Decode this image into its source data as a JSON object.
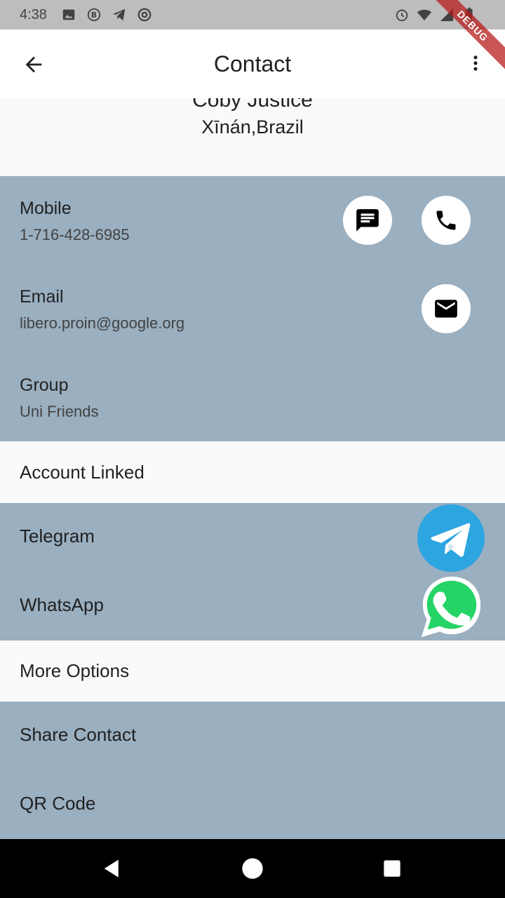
{
  "status_bar": {
    "time": "4:38",
    "left_icons": [
      "image-icon",
      "b-circle-icon",
      "telegram-icon",
      "at-icon"
    ],
    "right_icons": [
      "alarm-icon",
      "wifi-icon",
      "signal-icon",
      "battery-icon"
    ]
  },
  "debug_banner": "DEBUG",
  "app_bar": {
    "title": "Contact",
    "back_icon": "arrow-back-icon",
    "more_icon": "more-vert-icon"
  },
  "contact": {
    "name": "Coby Justice",
    "location": "Xīnán,Brazil"
  },
  "details": {
    "mobile_label": "Mobile",
    "mobile_value": "1-716-428-6985",
    "email_label": "Email",
    "email_value": "libero.proin@google.org",
    "group_label": "Group",
    "group_value": "Uni Friends"
  },
  "account_linked": {
    "heading": "Account Linked",
    "items": [
      "Telegram",
      "WhatsApp"
    ]
  },
  "more_options": {
    "heading": "More Options",
    "items": [
      "Share Contact",
      "QR Code"
    ]
  },
  "colors": {
    "section_bg": "#9aafc0",
    "white_bg": "#fafafa",
    "telegram": "#2ca5e0",
    "whatsapp": "#25d366"
  }
}
